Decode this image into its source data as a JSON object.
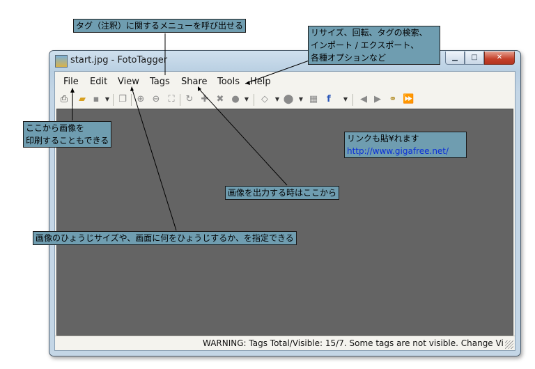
{
  "window": {
    "title": "start.jpg - FotoTagger",
    "minimize": "▁",
    "maximize": "□",
    "close": "✕"
  },
  "menu": [
    "File",
    "Edit",
    "View",
    "Tags",
    "Share",
    "Tools",
    "Help"
  ],
  "toolbar_icons": [
    "print-icon",
    "open-folder-icon",
    "save-icon",
    "dropdown-arrow-icon",
    "copy-icon",
    "zoom-in-icon",
    "zoom-out-icon",
    "fit-icon",
    "rotate-icon",
    "add-tag-icon",
    "delete-tag-icon",
    "light-bulb-icon",
    "dropdown-arrow-icon",
    "tag-icon",
    "dropdown-arrow-icon",
    "globe-icon",
    "dropdown-arrow-icon",
    "image-icon",
    "facebook-icon",
    "dropdown-arrow-icon",
    "back-icon",
    "forward-icon",
    "binoculars-icon",
    "slideshow-icon"
  ],
  "status": {
    "text": "WARNING: Tags Total/Visible: 15/7. Some tags are not visible. Change Vi"
  },
  "callouts": {
    "tags_menu": "タグ（注釈）に関するメニューを呼び出せる",
    "tools_line1": "リサイズ、回転、タグの検索、",
    "tools_line2": "インポート / エクスポート、",
    "tools_line3": "各種オプションなど",
    "print_line1": "ここから画像を",
    "print_line2": "印刷することもできる",
    "link_line1": "リンクも貼¥れます",
    "link_url": "http://www.gigafree.net/",
    "share": "画像を出力する時はここから",
    "view": "画像のひょうじサイズや、画面に何をひょうじするか、を指定できる"
  },
  "colors": {
    "callout_bg": "#6f9db0",
    "canvas_bg": "#646464",
    "link": "#0b2fd6"
  }
}
